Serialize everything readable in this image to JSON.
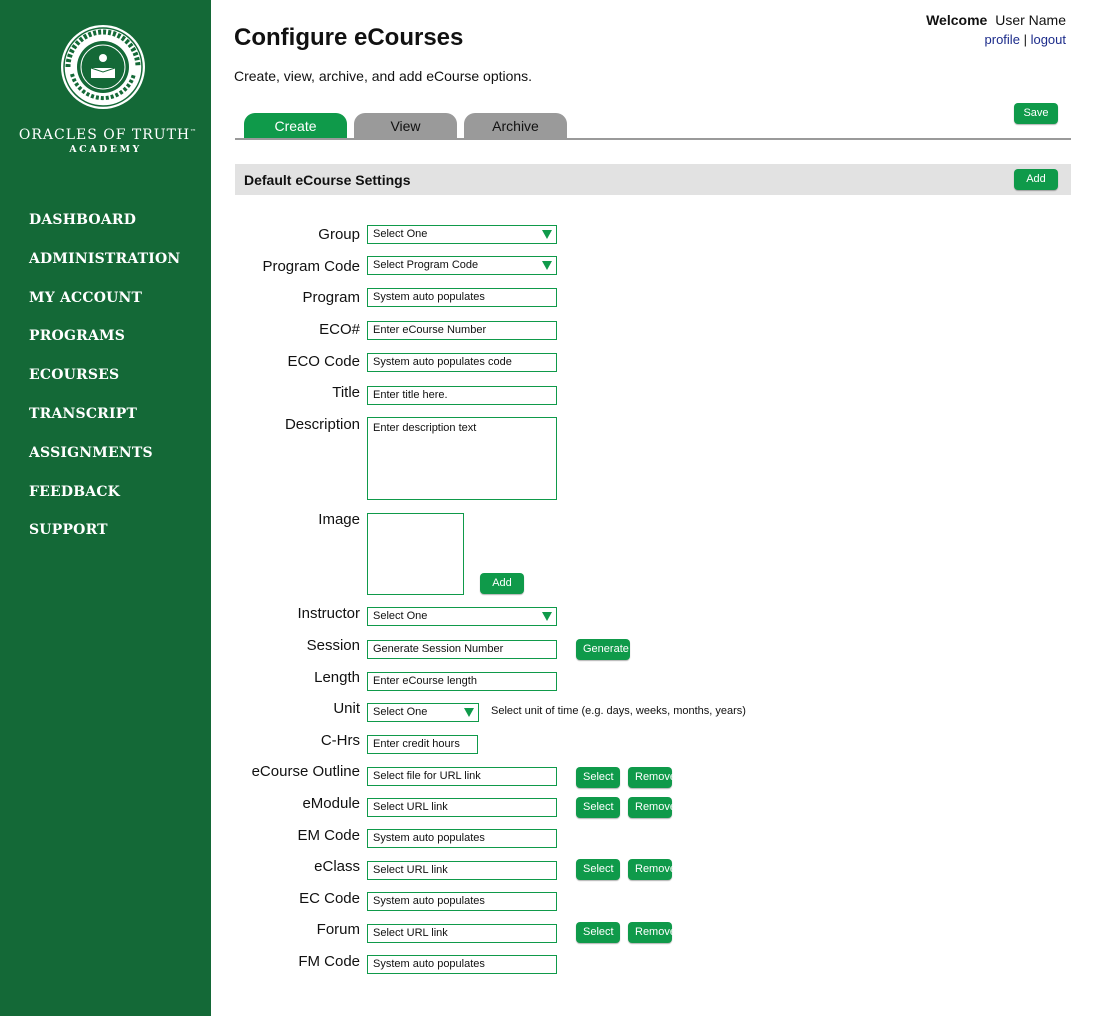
{
  "sidebar": {
    "brand": {
      "name": "ORACLES OF TRUTH",
      "tm": "™",
      "sub": "ACADEMY"
    },
    "nav": [
      "DASHBOARD",
      "ADMINISTRATION",
      "MY ACCOUNT",
      "PROGRAMS",
      "ECOURSES",
      "TRANSCRIPT",
      "ASSIGNMENTS",
      "FEEDBACK",
      "SUPPORT"
    ]
  },
  "header": {
    "title": "Configure eCourses",
    "subtitle": "Create, view, archive, and add eCourse options.",
    "welcome": "Welcome",
    "user_name": "User Name",
    "profile": "profile",
    "separator": "|",
    "logout": "logout"
  },
  "tabs": [
    {
      "label": "Create",
      "active": true
    },
    {
      "label": "View",
      "active": false
    },
    {
      "label": "Archive",
      "active": false
    }
  ],
  "buttons": {
    "save": "Save",
    "add": "Add",
    "generate": "Generate",
    "select": "Select",
    "remove": "Remove"
  },
  "section": {
    "title": "Default eCourse Settings"
  },
  "form": {
    "group": {
      "label": "Group",
      "value": "Select One"
    },
    "program_code": {
      "label": "Program Code",
      "value": "Select Program Code"
    },
    "program": {
      "label": "Program",
      "value": "System auto populates"
    },
    "eco_num": {
      "label": "ECO#",
      "value": "Enter eCourse Number"
    },
    "eco_code": {
      "label": "ECO Code",
      "value": "System auto populates code"
    },
    "title": {
      "label": "Title",
      "value": "Enter title here."
    },
    "description": {
      "label": "Description",
      "value": "Enter description text"
    },
    "image": {
      "label": "Image"
    },
    "instructor": {
      "label": "Instructor",
      "value": "Select One"
    },
    "session": {
      "label": "Session",
      "value": "Generate Session Number"
    },
    "length": {
      "label": "Length",
      "value": "Enter eCourse length"
    },
    "unit": {
      "label": "Unit",
      "value": "Select One",
      "hint": "Select unit of time (e.g. days, weeks, months, years)"
    },
    "chrs": {
      "label": "C-Hrs",
      "value": "Enter credit hours"
    },
    "outline": {
      "label": "eCourse Outline",
      "value": "Select file for URL link"
    },
    "emodule": {
      "label": "eModule",
      "value": "Select URL link"
    },
    "em_code": {
      "label": "EM Code",
      "value": "System auto populates"
    },
    "eclass": {
      "label": "eClass",
      "value": "Select URL link"
    },
    "ec_code": {
      "label": "EC Code",
      "value": "System auto populates"
    },
    "forum": {
      "label": "Forum",
      "value": "Select URL link"
    },
    "fm_code": {
      "label": "FM Code",
      "value": "System auto populates"
    }
  },
  "colors": {
    "sidebar": "#146937",
    "accent": "#0f9a4a",
    "tab_inactive": "#9a9a9a",
    "section_bar": "#e2e2e2",
    "link": "#1b2b8a"
  }
}
